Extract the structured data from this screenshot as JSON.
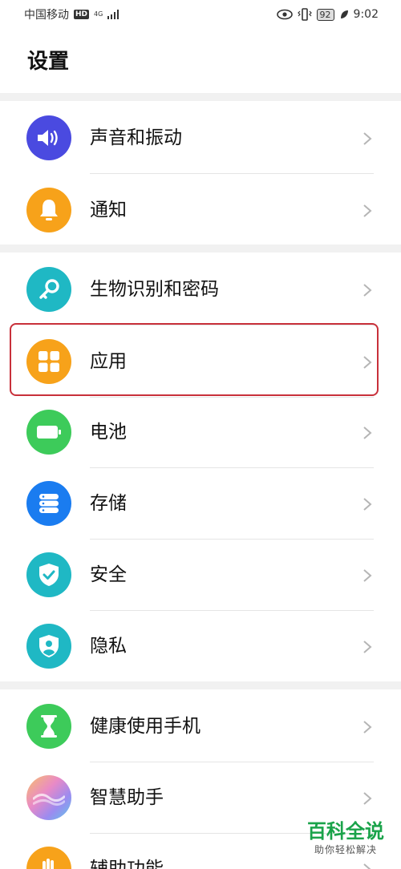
{
  "status_bar": {
    "carrier": "中国移动",
    "hd_badge": "HD",
    "network": "4G",
    "battery": "92",
    "time": "9:02"
  },
  "page": {
    "title": "设置"
  },
  "groups": [
    {
      "items": [
        {
          "label": "声音和振动",
          "icon": "speaker-icon",
          "color": "#4a4ae0"
        },
        {
          "label": "通知",
          "icon": "bell-icon",
          "color": "#f7a21a"
        }
      ]
    },
    {
      "items": [
        {
          "label": "生物识别和密码",
          "icon": "key-icon",
          "color": "#1fb8c4"
        },
        {
          "label": "应用",
          "icon": "apps-grid-icon",
          "color": "#f7a21a"
        },
        {
          "label": "电池",
          "icon": "battery-icon",
          "color": "#3dcb5a"
        },
        {
          "label": "存储",
          "icon": "storage-icon",
          "color": "#1a7cf0"
        },
        {
          "label": "安全",
          "icon": "shield-check-icon",
          "color": "#1fb8c4"
        },
        {
          "label": "隐私",
          "icon": "privacy-shield-icon",
          "color": "#1fb8c4"
        }
      ]
    },
    {
      "items": [
        {
          "label": "健康使用手机",
          "icon": "hourglass-icon",
          "color": "#3dcb5a"
        },
        {
          "label": "智慧助手",
          "icon": "assistant-icon",
          "color": "#c77be0"
        },
        {
          "label": "辅助功能",
          "icon": "hand-icon",
          "color": "#f7a21a"
        }
      ]
    }
  ],
  "watermark": {
    "main": "百科全说",
    "sub": "助你轻松解决"
  }
}
